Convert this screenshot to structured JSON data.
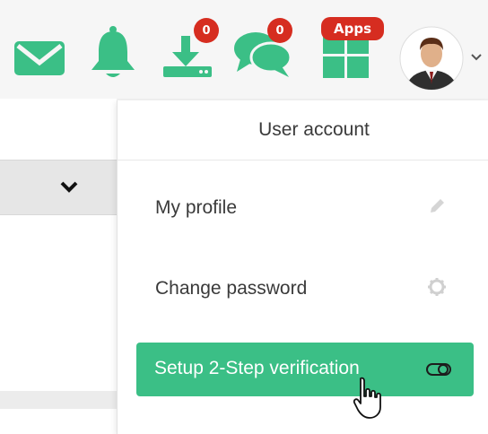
{
  "header": {
    "download_badge": "0",
    "chat_badge": "0",
    "apps_badge": "Apps"
  },
  "dropdown": {
    "title": "User account",
    "items": [
      {
        "label": "My profile",
        "icon": "pencil-icon"
      },
      {
        "label": "Change password",
        "icon": "gear-icon"
      },
      {
        "label": "Setup 2-Step verification",
        "icon": "toggle-icon",
        "active": true
      }
    ]
  },
  "colors": {
    "accent": "#3bbf86",
    "badge": "#d62d20"
  }
}
